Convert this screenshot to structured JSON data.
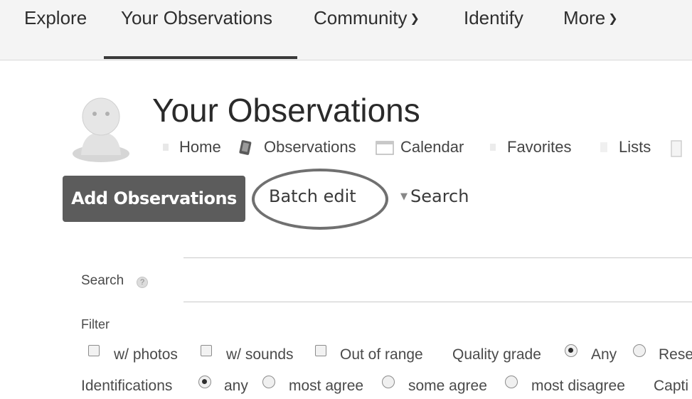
{
  "nav": {
    "items": [
      {
        "label": "Explore"
      },
      {
        "label": "Your Observations"
      },
      {
        "label": "Community"
      },
      {
        "label": "Identify"
      },
      {
        "label": "More"
      }
    ],
    "active": "Your Observations"
  },
  "header": {
    "title": "Your Observations"
  },
  "subnav": {
    "home": "Home",
    "observations": "Observations",
    "calendar": "Calendar",
    "favorites": "Favorites",
    "lists": "Lists"
  },
  "actions": {
    "add_observations": "Add Observations",
    "batch_edit": "Batch edit",
    "search_toggle": "Search"
  },
  "search": {
    "label": "Search",
    "value": ""
  },
  "filter": {
    "label": "Filter",
    "w_photos": "w/ photos",
    "w_sounds": "w/ sounds",
    "out_of_range": "Out of range",
    "quality_grade": "Quality grade",
    "quality_any": "Any",
    "quality_research": "Rese",
    "identifications": "Identifications",
    "id_any": "any",
    "id_most_agree": "most agree",
    "id_some_agree": "some agree",
    "id_most_disagree": "most disagree",
    "captive": "Capti"
  },
  "colors": {
    "primary_button": "#5c5c5c",
    "highlight_circle": "#707070",
    "nav_background": "#f4f4f4"
  }
}
